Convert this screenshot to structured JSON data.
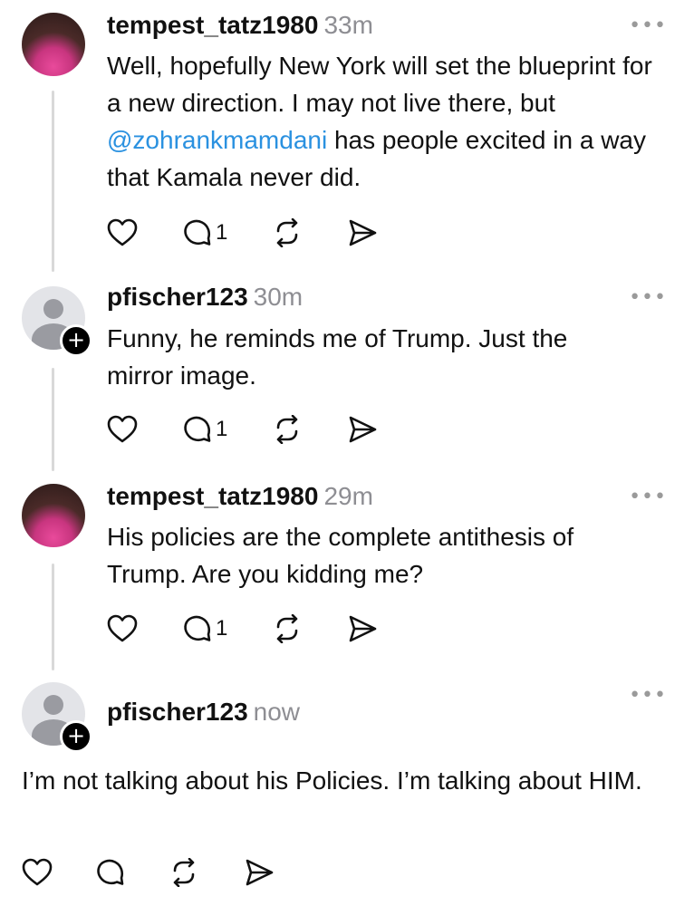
{
  "posts": [
    {
      "username": "tempest_tatz1980",
      "time": "33m",
      "text_before": "Well, hopefully New York will set the blueprint for a new direction. I may not live there, but ",
      "mention": "@zohrankmamdani",
      "text_after": " has people excited in a way that Kamala never did.",
      "reply_count": "1",
      "more": "•••"
    },
    {
      "username": "pfischer123",
      "time": "30m",
      "text": "Funny, he reminds me of Trump.  Just the mirror image.",
      "reply_count": "1",
      "more": "•••",
      "follow_badge": "+"
    },
    {
      "username": "tempest_tatz1980",
      "time": "29m",
      "text": "His policies are the complete antithesis of Trump. Are you kidding me?",
      "reply_count": "1",
      "more": "•••"
    },
    {
      "username": "pfischer123",
      "time": "now",
      "text": "I’m not talking about his Policies.  I’m talking about HIM.",
      "more": "•••",
      "follow_badge": "+"
    }
  ],
  "icons": {
    "like": "heart-icon",
    "reply": "comment-icon",
    "repost": "repost-icon",
    "share": "send-icon"
  },
  "colors": {
    "mention": "#2a91e0",
    "timestamp": "#8e8e93",
    "thread_line": "#d9d9d9"
  }
}
